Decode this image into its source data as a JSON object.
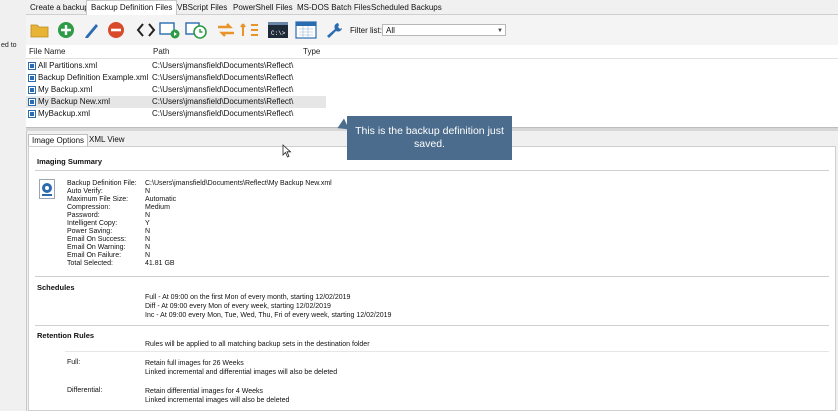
{
  "left_strip": {
    "text": "ed to"
  },
  "tabs": [
    {
      "label": "Create a backup"
    },
    {
      "label": "Backup Definition Files"
    },
    {
      "label": "VBScript Files"
    },
    {
      "label": "PowerShell Files"
    },
    {
      "label": "MS-DOS Batch Files"
    },
    {
      "label": "Scheduled Backups"
    }
  ],
  "toolbar": {
    "filter_label": "Filter list:",
    "filter_value": "All",
    "icons": [
      "folder-open-icon",
      "add-icon",
      "edit-icon",
      "delete-icon",
      "code-icon",
      "run-icon",
      "schedule-icon",
      "refresh-icon",
      "swap-icon",
      "command-prompt-icon",
      "calendar-icon",
      "settings-wrench-icon"
    ],
    "cmd_text": "C:\\>",
    "colors": {
      "add": "#2e9b46",
      "delete": "#d84a2a",
      "folder": "#e8b436",
      "accent": "#2b6cb0"
    }
  },
  "file_list": {
    "columns": [
      "File Name",
      "Path",
      "Type"
    ],
    "rows": [
      {
        "name": "All Partitions.xml",
        "path": "C:\\Users\\jmansfield\\Documents\\Reflect\\"
      },
      {
        "name": "Backup Definition Example.xml",
        "path": "C:\\Users\\jmansfield\\Documents\\Reflect\\"
      },
      {
        "name": "My Backup.xml",
        "path": "C:\\Users\\jmansfield\\Documents\\Reflect\\"
      },
      {
        "name": "My Backup New.xml",
        "path": "C:\\Users\\jmansfield\\Documents\\Reflect\\",
        "selected": true
      },
      {
        "name": "MyBackup.xml",
        "path": "C:\\Users\\jmansfield\\Documents\\Reflect\\"
      }
    ]
  },
  "inner_tabs": [
    {
      "label": "Image Options"
    },
    {
      "label": "XML View"
    }
  ],
  "summary": {
    "title": "Imaging Summary",
    "items": [
      {
        "label": "Backup Definition File:",
        "value": "C:\\Users\\jmansfield\\Documents\\Reflect\\My Backup New.xml"
      },
      {
        "label": "Auto Verify:",
        "value": "N"
      },
      {
        "label": "Maximum File Size:",
        "value": "Automatic"
      },
      {
        "label": "Compression:",
        "value": "Medium"
      },
      {
        "label": "Password:",
        "value": "N"
      },
      {
        "label": "Intelligent Copy:",
        "value": "Y"
      },
      {
        "label": "Power Saving:",
        "value": "N"
      },
      {
        "label": "Email On Success:",
        "value": "N"
      },
      {
        "label": "Email On Warning:",
        "value": "N"
      },
      {
        "label": "Email On Failure:",
        "value": "N"
      },
      {
        "label": "Total Selected:",
        "value": "41.81 GB"
      }
    ]
  },
  "schedules": {
    "title": "Schedules",
    "lines": [
      "Full - At 09:00 on the first Mon of every month, starting 12/02/2019",
      "Diff - At 09:00 every Mon of every week, starting 12/02/2019",
      "Inc - At 09:00 every Mon, Tue, Wed, Thu, Fri of every week, starting 12/02/2019"
    ]
  },
  "retention": {
    "title": "Retention Rules",
    "intro": "Rules will be applied to all matching backup sets in the destination folder",
    "rules": [
      {
        "label": "Full:",
        "lines": [
          "Retain full images for 26 Weeks",
          "Linked incremental and differential images will also be deleted"
        ]
      },
      {
        "label": "Differential:",
        "lines": [
          "Retain differential images for 4 Weeks",
          "Linked incremental images will also be deleted"
        ]
      }
    ]
  },
  "tooltip": {
    "text": "This is the backup definition just saved."
  }
}
